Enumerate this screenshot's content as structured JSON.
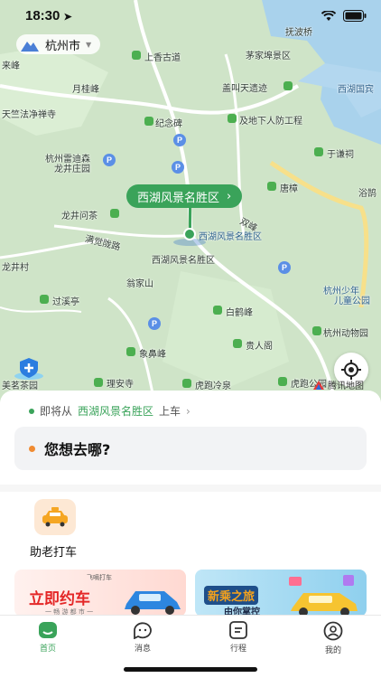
{
  "status_bar": {
    "time": "18:30"
  },
  "city": {
    "name": "杭州市"
  },
  "map": {
    "labels": [
      {
        "text": "抚波桥",
        "cls": ""
      },
      {
        "text": "上香古道",
        "cls": ""
      },
      {
        "text": "茅家埠景区",
        "cls": ""
      },
      {
        "text": "来峰",
        "cls": ""
      },
      {
        "text": "月桂峰",
        "cls": ""
      },
      {
        "text": "盖叫天遗迹",
        "cls": ""
      },
      {
        "text": "西湖国宾",
        "cls": ""
      },
      {
        "text": "天竺法净禅寺",
        "cls": ""
      },
      {
        "text": "纪念碑",
        "cls": ""
      },
      {
        "text": "及地下人防工程",
        "cls": ""
      },
      {
        "text": "于谦祠",
        "cls": ""
      },
      {
        "text": "杭州雷迪森",
        "cls": ""
      },
      {
        "text": "龙井庄园",
        "cls": ""
      },
      {
        "text": "唐樟",
        "cls": ""
      },
      {
        "text": "浴鹄",
        "cls": ""
      },
      {
        "text": "龙井问茶",
        "cls": ""
      },
      {
        "text": "双峰",
        "cls": ""
      },
      {
        "text": "西湖风景名胜区",
        "cls": "blue"
      },
      {
        "text": "满觉陇路",
        "cls": ""
      },
      {
        "text": "龙井村",
        "cls": ""
      },
      {
        "text": "西湖风景名胜区",
        "cls": ""
      },
      {
        "text": "翁家山",
        "cls": ""
      },
      {
        "text": "杭州少年",
        "cls": "blue"
      },
      {
        "text": "儿童公园",
        "cls": "blue"
      },
      {
        "text": "过溪亭",
        "cls": ""
      },
      {
        "text": "白鹤峰",
        "cls": ""
      },
      {
        "text": "杭州动物园",
        "cls": ""
      },
      {
        "text": "象鼻峰",
        "cls": ""
      },
      {
        "text": "贵人阁",
        "cls": ""
      },
      {
        "text": "美茗茶园",
        "cls": ""
      },
      {
        "text": "理安寺",
        "cls": ""
      },
      {
        "text": "虎跑冷泉",
        "cls": ""
      },
      {
        "text": "虎跑公园",
        "cls": ""
      }
    ],
    "pickup_bubble": "西湖风景名胜区",
    "provider": "腾讯地图"
  },
  "sheet": {
    "pickup_prefix": "即将从",
    "pickup_place": "西湖风景名胜区",
    "pickup_suffix": "上车",
    "destination_placeholder": "您想去哪?",
    "service_label": "助老打车",
    "promo_left": {
      "brand": "飞嘀打车",
      "title": "立即约车",
      "sub": "一 畅 游 都 市 一"
    },
    "promo_right": {
      "title": "新乘之旅",
      "sub": "由你掌控"
    }
  },
  "tabs": [
    {
      "label": "首页",
      "active": true,
      "icon": "home-icon"
    },
    {
      "label": "消息",
      "active": false,
      "icon": "message-icon"
    },
    {
      "label": "行程",
      "active": false,
      "icon": "trip-icon"
    },
    {
      "label": "我的",
      "active": false,
      "icon": "profile-icon"
    }
  ],
  "colors": {
    "accent": "#3aa35a",
    "map_bg": "#cfe4c8",
    "orange": "#f08b32"
  }
}
